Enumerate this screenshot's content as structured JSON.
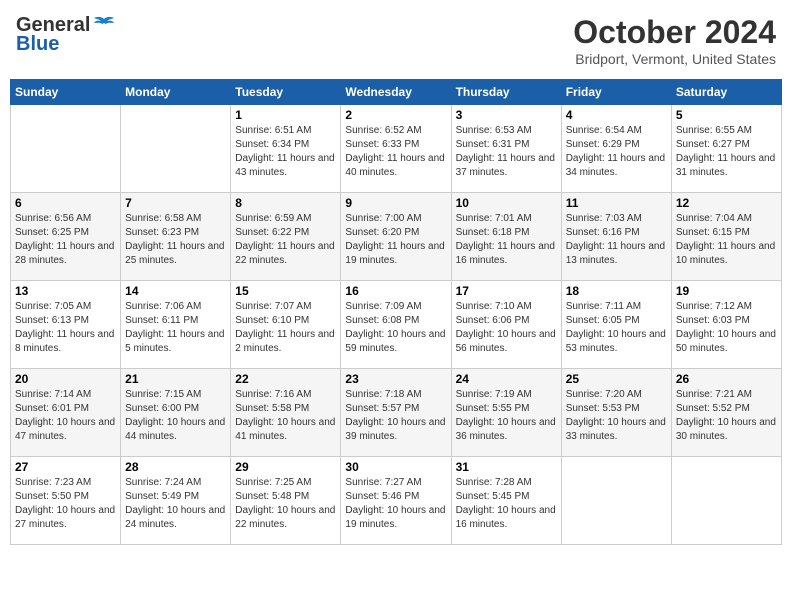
{
  "header": {
    "logo_general": "General",
    "logo_blue": "Blue",
    "month_title": "October 2024",
    "location": "Bridport, Vermont, United States"
  },
  "days_of_week": [
    "Sunday",
    "Monday",
    "Tuesday",
    "Wednesday",
    "Thursday",
    "Friday",
    "Saturday"
  ],
  "weeks": [
    [
      {
        "day": "",
        "sunrise": "",
        "sunset": "",
        "daylight": ""
      },
      {
        "day": "",
        "sunrise": "",
        "sunset": "",
        "daylight": ""
      },
      {
        "day": "1",
        "sunrise": "Sunrise: 6:51 AM",
        "sunset": "Sunset: 6:34 PM",
        "daylight": "Daylight: 11 hours and 43 minutes."
      },
      {
        "day": "2",
        "sunrise": "Sunrise: 6:52 AM",
        "sunset": "Sunset: 6:33 PM",
        "daylight": "Daylight: 11 hours and 40 minutes."
      },
      {
        "day": "3",
        "sunrise": "Sunrise: 6:53 AM",
        "sunset": "Sunset: 6:31 PM",
        "daylight": "Daylight: 11 hours and 37 minutes."
      },
      {
        "day": "4",
        "sunrise": "Sunrise: 6:54 AM",
        "sunset": "Sunset: 6:29 PM",
        "daylight": "Daylight: 11 hours and 34 minutes."
      },
      {
        "day": "5",
        "sunrise": "Sunrise: 6:55 AM",
        "sunset": "Sunset: 6:27 PM",
        "daylight": "Daylight: 11 hours and 31 minutes."
      }
    ],
    [
      {
        "day": "6",
        "sunrise": "Sunrise: 6:56 AM",
        "sunset": "Sunset: 6:25 PM",
        "daylight": "Daylight: 11 hours and 28 minutes."
      },
      {
        "day": "7",
        "sunrise": "Sunrise: 6:58 AM",
        "sunset": "Sunset: 6:23 PM",
        "daylight": "Daylight: 11 hours and 25 minutes."
      },
      {
        "day": "8",
        "sunrise": "Sunrise: 6:59 AM",
        "sunset": "Sunset: 6:22 PM",
        "daylight": "Daylight: 11 hours and 22 minutes."
      },
      {
        "day": "9",
        "sunrise": "Sunrise: 7:00 AM",
        "sunset": "Sunset: 6:20 PM",
        "daylight": "Daylight: 11 hours and 19 minutes."
      },
      {
        "day": "10",
        "sunrise": "Sunrise: 7:01 AM",
        "sunset": "Sunset: 6:18 PM",
        "daylight": "Daylight: 11 hours and 16 minutes."
      },
      {
        "day": "11",
        "sunrise": "Sunrise: 7:03 AM",
        "sunset": "Sunset: 6:16 PM",
        "daylight": "Daylight: 11 hours and 13 minutes."
      },
      {
        "day": "12",
        "sunrise": "Sunrise: 7:04 AM",
        "sunset": "Sunset: 6:15 PM",
        "daylight": "Daylight: 11 hours and 10 minutes."
      }
    ],
    [
      {
        "day": "13",
        "sunrise": "Sunrise: 7:05 AM",
        "sunset": "Sunset: 6:13 PM",
        "daylight": "Daylight: 11 hours and 8 minutes."
      },
      {
        "day": "14",
        "sunrise": "Sunrise: 7:06 AM",
        "sunset": "Sunset: 6:11 PM",
        "daylight": "Daylight: 11 hours and 5 minutes."
      },
      {
        "day": "15",
        "sunrise": "Sunrise: 7:07 AM",
        "sunset": "Sunset: 6:10 PM",
        "daylight": "Daylight: 11 hours and 2 minutes."
      },
      {
        "day": "16",
        "sunrise": "Sunrise: 7:09 AM",
        "sunset": "Sunset: 6:08 PM",
        "daylight": "Daylight: 10 hours and 59 minutes."
      },
      {
        "day": "17",
        "sunrise": "Sunrise: 7:10 AM",
        "sunset": "Sunset: 6:06 PM",
        "daylight": "Daylight: 10 hours and 56 minutes."
      },
      {
        "day": "18",
        "sunrise": "Sunrise: 7:11 AM",
        "sunset": "Sunset: 6:05 PM",
        "daylight": "Daylight: 10 hours and 53 minutes."
      },
      {
        "day": "19",
        "sunrise": "Sunrise: 7:12 AM",
        "sunset": "Sunset: 6:03 PM",
        "daylight": "Daylight: 10 hours and 50 minutes."
      }
    ],
    [
      {
        "day": "20",
        "sunrise": "Sunrise: 7:14 AM",
        "sunset": "Sunset: 6:01 PM",
        "daylight": "Daylight: 10 hours and 47 minutes."
      },
      {
        "day": "21",
        "sunrise": "Sunrise: 7:15 AM",
        "sunset": "Sunset: 6:00 PM",
        "daylight": "Daylight: 10 hours and 44 minutes."
      },
      {
        "day": "22",
        "sunrise": "Sunrise: 7:16 AM",
        "sunset": "Sunset: 5:58 PM",
        "daylight": "Daylight: 10 hours and 41 minutes."
      },
      {
        "day": "23",
        "sunrise": "Sunrise: 7:18 AM",
        "sunset": "Sunset: 5:57 PM",
        "daylight": "Daylight: 10 hours and 39 minutes."
      },
      {
        "day": "24",
        "sunrise": "Sunrise: 7:19 AM",
        "sunset": "Sunset: 5:55 PM",
        "daylight": "Daylight: 10 hours and 36 minutes."
      },
      {
        "day": "25",
        "sunrise": "Sunrise: 7:20 AM",
        "sunset": "Sunset: 5:53 PM",
        "daylight": "Daylight: 10 hours and 33 minutes."
      },
      {
        "day": "26",
        "sunrise": "Sunrise: 7:21 AM",
        "sunset": "Sunset: 5:52 PM",
        "daylight": "Daylight: 10 hours and 30 minutes."
      }
    ],
    [
      {
        "day": "27",
        "sunrise": "Sunrise: 7:23 AM",
        "sunset": "Sunset: 5:50 PM",
        "daylight": "Daylight: 10 hours and 27 minutes."
      },
      {
        "day": "28",
        "sunrise": "Sunrise: 7:24 AM",
        "sunset": "Sunset: 5:49 PM",
        "daylight": "Daylight: 10 hours and 24 minutes."
      },
      {
        "day": "29",
        "sunrise": "Sunrise: 7:25 AM",
        "sunset": "Sunset: 5:48 PM",
        "daylight": "Daylight: 10 hours and 22 minutes."
      },
      {
        "day": "30",
        "sunrise": "Sunrise: 7:27 AM",
        "sunset": "Sunset: 5:46 PM",
        "daylight": "Daylight: 10 hours and 19 minutes."
      },
      {
        "day": "31",
        "sunrise": "Sunrise: 7:28 AM",
        "sunset": "Sunset: 5:45 PM",
        "daylight": "Daylight: 10 hours and 16 minutes."
      },
      {
        "day": "",
        "sunrise": "",
        "sunset": "",
        "daylight": ""
      },
      {
        "day": "",
        "sunrise": "",
        "sunset": "",
        "daylight": ""
      }
    ]
  ]
}
